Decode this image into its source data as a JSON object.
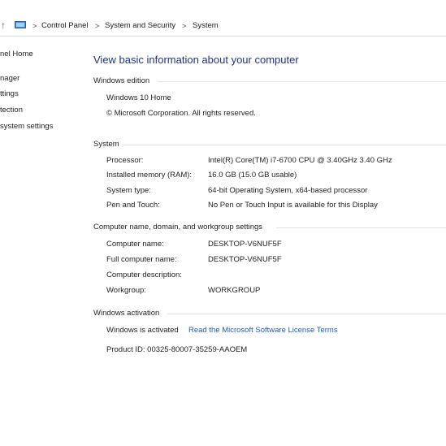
{
  "breadcrumb": {
    "items": [
      "Control Panel",
      "System and Security",
      "System"
    ],
    "separator": ">"
  },
  "sidebar": {
    "items": [
      "nel Home",
      "nager",
      "ttings",
      "tection",
      "system settings"
    ]
  },
  "main": {
    "title": "View basic information about your computer",
    "edition": {
      "heading": "Windows edition",
      "name": "Windows 10 Home",
      "copyright": "© Microsoft Corporation. All rights reserved."
    },
    "system": {
      "heading": "System",
      "rows": [
        {
          "label": "Processor:",
          "value": "Intel(R) Core(TM) i7-6700 CPU @ 3.40GHz   3.40 GHz"
        },
        {
          "label": "Installed memory (RAM):",
          "value": "16.0 GB (15.0 GB usable)"
        },
        {
          "label": "System type:",
          "value": "64-bit Operating System, x64-based processor"
        },
        {
          "label": "Pen and Touch:",
          "value": "No Pen or Touch Input is available for this Display"
        }
      ]
    },
    "computer": {
      "heading": "Computer name, domain, and workgroup settings",
      "rows": [
        {
          "label": "Computer name:",
          "value": "DESKTOP-V6NUF5F"
        },
        {
          "label": "Full computer name:",
          "value": "DESKTOP-V6NUF5F"
        },
        {
          "label": "Computer description:",
          "value": ""
        },
        {
          "label": "Workgroup:",
          "value": "WORKGROUP"
        }
      ]
    },
    "activation": {
      "heading": "Windows activation",
      "status": "Windows is activated",
      "license_link": "Read the Microsoft Software License Terms",
      "product_id": "Product ID: 00325-80007-35259-AAOEM"
    }
  },
  "colors": {
    "title": "#1e3287",
    "link": "#1b5fb4"
  },
  "icons": {
    "up": "up-arrow-icon",
    "location": "control-panel-icon"
  }
}
